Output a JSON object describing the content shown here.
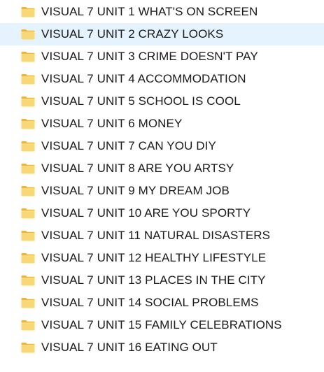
{
  "folders": [
    {
      "label": "VISUAL 7 UNIT 1 WHAT'S ON SCREEN",
      "icon": "folder-icon",
      "hovered": false
    },
    {
      "label": "VISUAL 7 UNIT 2 CRAZY LOOKS",
      "icon": "folder-icon",
      "hovered": true
    },
    {
      "label": "VISUAL 7 UNIT 3 CRIME DOESN'T PAY",
      "icon": "folder-icon",
      "hovered": false
    },
    {
      "label": "VISUAL 7 UNIT 4 ACCOMMODATION",
      "icon": "folder-icon",
      "hovered": false
    },
    {
      "label": "VISUAL 7 UNIT 5 SCHOOL IS COOL",
      "icon": "folder-icon",
      "hovered": false
    },
    {
      "label": "VISUAL 7 UNIT 6 MONEY",
      "icon": "folder-icon",
      "hovered": false
    },
    {
      "label": "VISUAL 7 UNIT 7 CAN YOU DIY",
      "icon": "folder-icon",
      "hovered": false
    },
    {
      "label": "VISUAL 7 UNIT 8 ARE YOU ARTSY",
      "icon": "folder-icon",
      "hovered": false
    },
    {
      "label": "VISUAL 7 UNIT 9 MY DREAM JOB",
      "icon": "folder-icon",
      "hovered": false
    },
    {
      "label": "VISUAL 7 UNIT 10 ARE YOU SPORTY",
      "icon": "folder-icon",
      "hovered": false
    },
    {
      "label": "VISUAL 7 UNIT 11 NATURAL DISASTERS",
      "icon": "folder-icon",
      "hovered": false
    },
    {
      "label": "VISUAL 7 UNIT 12 HEALTHY LIFESTYLE",
      "icon": "folder-icon",
      "hovered": false
    },
    {
      "label": "VISUAL 7 UNIT 13 PLACES IN THE CITY",
      "icon": "folder-icon",
      "hovered": false
    },
    {
      "label": "VISUAL 7 UNIT 14 SOCIAL PROBLEMS",
      "icon": "folder-icon",
      "hovered": false
    },
    {
      "label": "VISUAL 7 UNIT 15 FAMILY CELEBRATIONS",
      "icon": "folder-icon",
      "hovered": false
    },
    {
      "label": "VISUAL 7 UNIT 16 EATING OUT",
      "icon": "folder-icon",
      "hovered": false
    }
  ],
  "colors": {
    "folder_body": "#f8d775",
    "folder_tab": "#e8b548",
    "hover_background": "#e5f3ff",
    "text": "#1a1a1a"
  }
}
